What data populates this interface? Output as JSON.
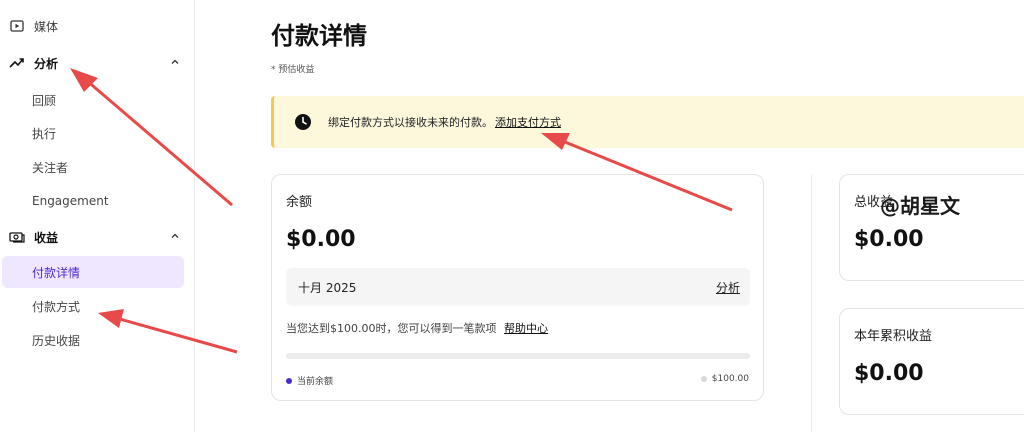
{
  "sidebar": {
    "items": [
      {
        "label": "媒体",
        "icon": "play-icon"
      },
      {
        "label": "分析",
        "icon": "trending-up-icon"
      },
      {
        "label": "回顾"
      },
      {
        "label": "执行"
      },
      {
        "label": "关注者"
      },
      {
        "label": "Engagement"
      },
      {
        "label": "收益",
        "icon": "money-icon"
      },
      {
        "label": "付款详情"
      },
      {
        "label": "付款方式"
      },
      {
        "label": "历史收据"
      }
    ]
  },
  "page": {
    "title": "付款详情",
    "note": "* 预估收益"
  },
  "banner": {
    "text": "绑定付款方式以接收未来的付款。",
    "link": "添加支付方式",
    "icon": "clock-icon"
  },
  "balance_card": {
    "label": "余额",
    "amount": "$0.00",
    "month": "十月 2025",
    "analysis_link": "分析",
    "hint": "当您达到$100.00时，您可以得到一笔款项",
    "help_link": "帮助中心",
    "progress_fraction": 0,
    "current_label": "当前余额",
    "threshold_label": "$100.00"
  },
  "total_card": {
    "label": "总收益",
    "amount": "$0.00"
  },
  "year_card": {
    "label": "本年累积收益",
    "amount": "$0.00"
  },
  "watermark": "@胡星文",
  "colors": {
    "accent": "#4b2ad6",
    "active_bg": "#efe6ff",
    "banner_bg": "#fdf8dc",
    "banner_border": "#f2c94c",
    "annotation_arrow": "#e84a4a"
  }
}
